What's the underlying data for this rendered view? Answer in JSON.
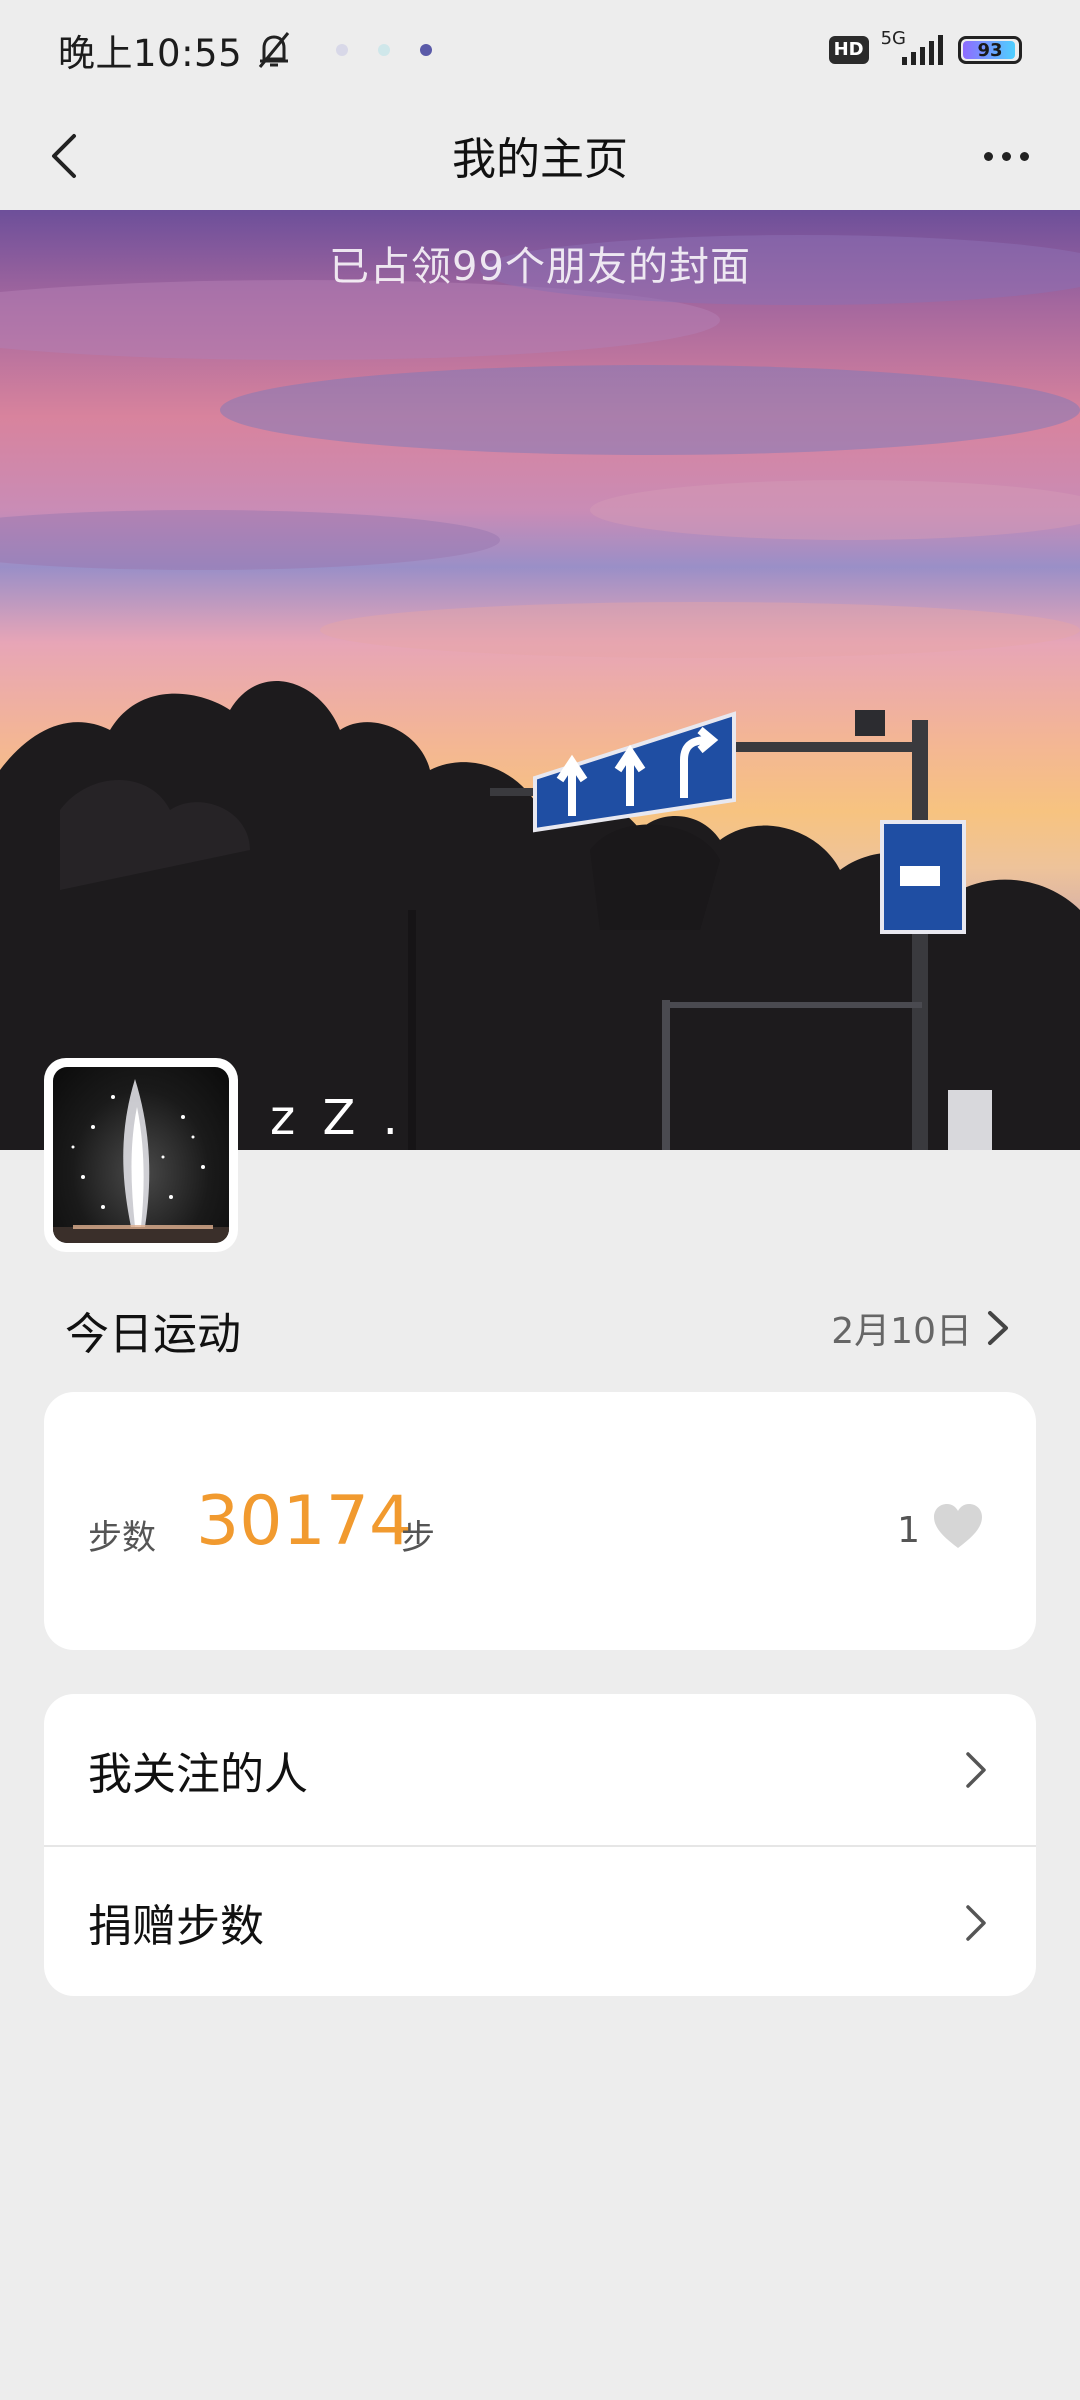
{
  "status_bar": {
    "time": "晚上10:55",
    "hd": "HD",
    "network": "5G",
    "battery": "93",
    "icons": [
      "mute-bell-icon",
      "app-dot-icon",
      "app-dot-icon",
      "app-dot-icon",
      "hd-icon",
      "signal-icon",
      "battery-icon"
    ]
  },
  "header": {
    "title": "我的主页",
    "back_icon": "chevron-left-icon",
    "more_icon": "more-dots-icon"
  },
  "cover": {
    "caption": "已占领99个朋友的封面"
  },
  "profile": {
    "username": "z Z ."
  },
  "today": {
    "section_title": "今日运动",
    "date": "2月10日",
    "steps_label": "步数",
    "steps_value": "30174",
    "steps_unit": "步",
    "likes": "1"
  },
  "menu": {
    "items": [
      {
        "label": "我关注的人"
      },
      {
        "label": "捐赠步数"
      }
    ]
  },
  "colors": {
    "accent_orange": "#f19a2f",
    "background": "#ededed",
    "card": "#ffffff"
  }
}
